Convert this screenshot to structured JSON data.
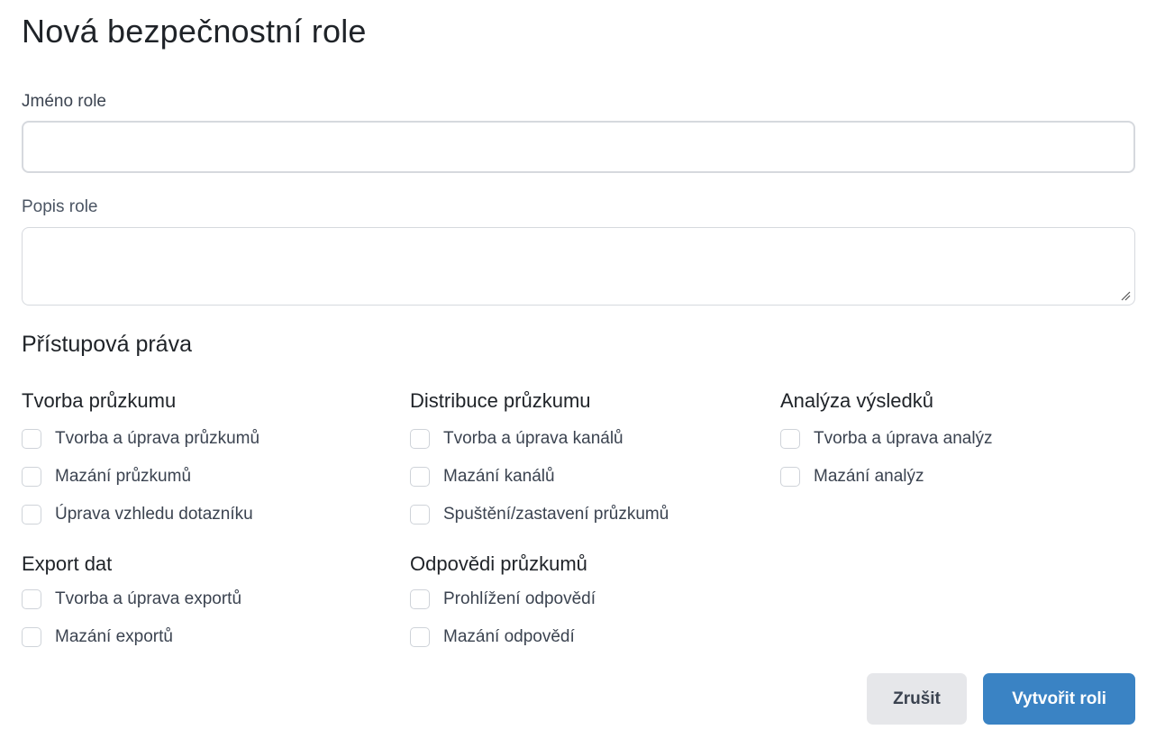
{
  "page": {
    "title": "Nová bezpečnostní role"
  },
  "form": {
    "name_label": "Jméno role",
    "name_value": "",
    "description_label": "Popis role",
    "description_value": ""
  },
  "permissions": {
    "section_title": "Přístupová práva",
    "groups": [
      {
        "title": "Tvorba průzkumu",
        "items": [
          "Tvorba a úprava průzkumů",
          "Mazání průzkumů",
          "Úprava vzhledu dotazníku"
        ]
      },
      {
        "title": "Distribuce průzkumu",
        "items": [
          "Tvorba a úprava kanálů",
          "Mazání kanálů",
          "Spuštění/zastavení průzkumů"
        ]
      },
      {
        "title": "Analýza výsledků",
        "items": [
          "Tvorba a úprava analýz",
          "Mazání analýz"
        ]
      },
      {
        "title": "Export dat",
        "items": [
          "Tvorba a úprava exportů",
          "Mazání exportů"
        ]
      },
      {
        "title": "Odpovědi průzkumů",
        "items": [
          "Prohlížení odpovědí",
          "Mazání odpovědí"
        ]
      }
    ]
  },
  "actions": {
    "cancel_label": "Zrušit",
    "create_label": "Vytvořit roli"
  },
  "colors": {
    "primary": "#3a83c4",
    "secondary_button": "#e6e7ea",
    "border": "#d6d9de"
  }
}
